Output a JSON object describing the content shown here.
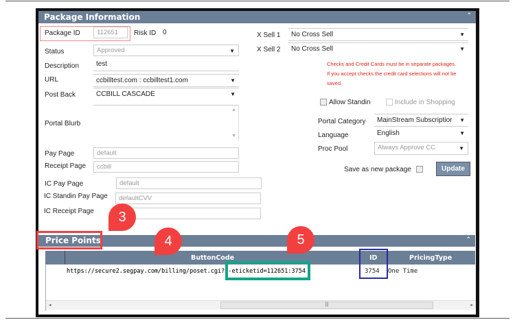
{
  "package_info": {
    "title": "Package Information",
    "package_id_label": "Package ID",
    "package_id": "112651",
    "risk_id_label": "Risk ID",
    "risk_id": "0",
    "status_label": "Status",
    "status": "Approved",
    "description_label": "Description",
    "description": "test",
    "url_label": "URL",
    "url": "ccbilltest.com : ccbilltest1.com",
    "post_back_label": "Post Back",
    "post_back": "CCBILL CASCADE",
    "portal_blurb_label": "Portal Blurb",
    "pay_page_label": "Pay Page",
    "pay_page": "default",
    "receipt_page_label": "Receipt Page",
    "receipt_page": "ccbill",
    "ic_pay_page_label": "IC Pay Page",
    "ic_pay_page": "default",
    "ic_standin_label": "IC Standin Pay Page",
    "ic_standin": "defaultCVV",
    "ic_receipt_label": "IC Receipt Page",
    "ic_receipt": "",
    "xsell1_label": "X Sell 1",
    "xsell1": "No Cross Sell",
    "xsell2_label": "X Sell 2",
    "xsell2": "No Cross Sell",
    "warning": "Checks and Credit Cards must be in separate packages. If you accept checks the credit card selections will not be saved.",
    "allow_standin": "Allow Standin",
    "include_shopping": "Include in Shopping",
    "portal_category_label": "Portal Category",
    "portal_category": "MainStream Subscriptior",
    "language_label": "Language",
    "language": "English",
    "proc_pool_label": "Proc Pool",
    "proc_pool": "Always Approve CC",
    "save_new_label": "Save as new package",
    "update": "Update"
  },
  "price_points": {
    "title": "Price Points",
    "columns": [
      "ButtonCode",
      "ID",
      "PricingType"
    ],
    "rows": [
      {
        "button_code": "https://secure2.segpay.com/billing/poset.cgi?x-eticketid=112651:3754",
        "button_code_prefix": "https://secure2.segpay.com/billing/poset.cgi?x",
        "button_code_suffix": "eticketid=112651:3754",
        "id": "3754",
        "pricing_type": "One Time"
      }
    ]
  },
  "callouts": [
    "3",
    "4",
    "5"
  ],
  "colors": {
    "header": "#6b7f96",
    "callout": "#f24040",
    "highlight_green": "#12a58a",
    "highlight_blue": "#2a2aa0",
    "highlight_red": "#f24040"
  }
}
